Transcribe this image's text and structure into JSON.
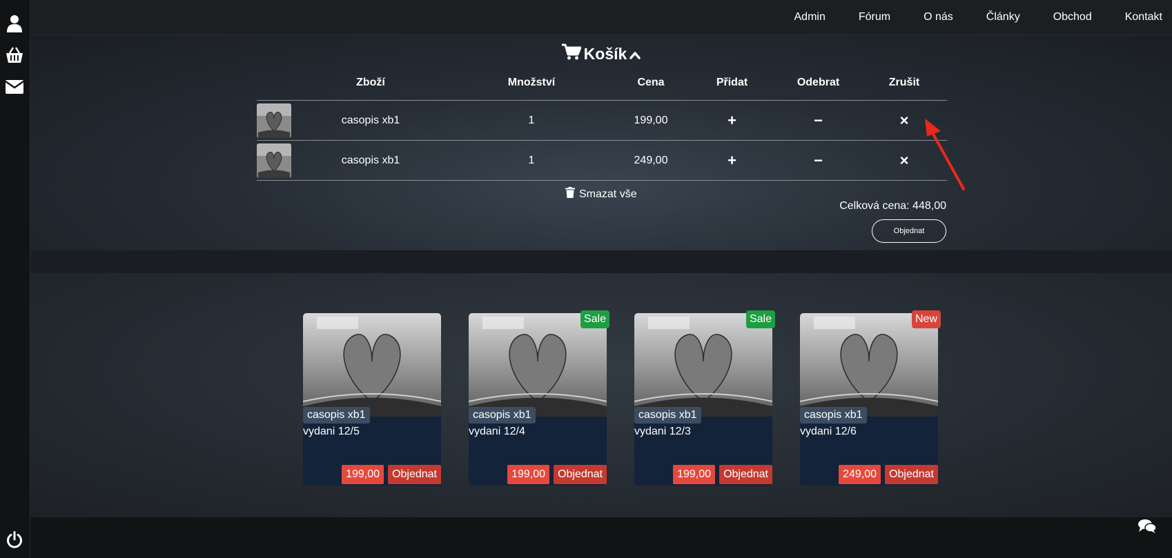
{
  "sidebar": {
    "icons": [
      "user-icon",
      "basket-icon",
      "envelope-icon",
      "power-icon"
    ]
  },
  "nav": {
    "items": [
      "Admin",
      "Fórum",
      "O nás",
      "Články",
      "Obchod",
      "Kontakt"
    ]
  },
  "cart": {
    "title": "Košík",
    "headers": [
      "Zboží",
      "Množství",
      "Cena",
      "Přidat",
      "Odebrat",
      "Zrušit"
    ],
    "rows": [
      {
        "name": "casopis xb1",
        "qty": "1",
        "price": "199,00"
      },
      {
        "name": "casopis xb1",
        "qty": "1",
        "price": "249,00"
      }
    ],
    "add_symbol": "+",
    "remove_symbol": "−",
    "cancel_symbol": "×",
    "clear_all": "Smazat vše",
    "total": "Celková cena: 448,00",
    "order_button": "Objednat"
  },
  "products": [
    {
      "name": "casopis xb1",
      "edition": "vydani 12/5",
      "price": "199,00",
      "buy": "Objednat",
      "badge": ""
    },
    {
      "name": "casopis xb1",
      "edition": "vydani 12/4",
      "price": "199,00",
      "buy": "Objednat",
      "badge": "Sale"
    },
    {
      "name": "casopis xb1",
      "edition": "vydani 12/3",
      "price": "199,00",
      "buy": "Objednat",
      "badge": "Sale"
    },
    {
      "name": "casopis xb1",
      "edition": "vydani 12/6",
      "price": "249,00",
      "buy": "Objednat",
      "badge": "New"
    }
  ],
  "colors": {
    "sale_badge": "#1e9e43",
    "new_badge": "#d9443a",
    "price_tag": "#e4493c",
    "buy_button": "#c43a30",
    "card_body": "#13233a",
    "annotation_arrow": "#e8291c"
  },
  "footer": {
    "chat_icon": "chat-bubbles-icon"
  }
}
